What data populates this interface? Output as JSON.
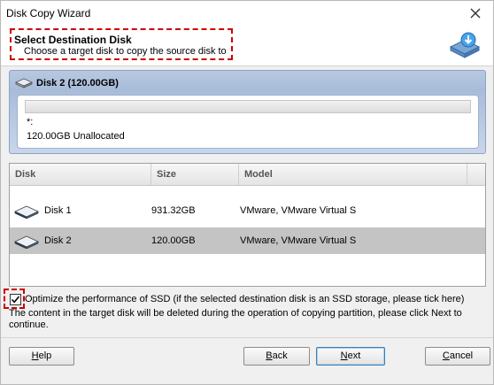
{
  "window": {
    "title": "Disk Copy Wizard"
  },
  "header": {
    "title": "Select Destination Disk",
    "subtitle": "Choose a target disk to copy the source disk to"
  },
  "disk_panel": {
    "title": "Disk 2 (120.00GB)",
    "partition_name": "*:",
    "partition_desc": "120.00GB Unallocated"
  },
  "table": {
    "columns": [
      "Disk",
      "Size",
      "Model"
    ],
    "rows": [
      {
        "disk": "Disk 1",
        "size": "931.32GB",
        "model": "VMware, VMware Virtual S",
        "selected": false
      },
      {
        "disk": "Disk 2",
        "size": "120.00GB",
        "model": "VMware, VMware Virtual S",
        "selected": true
      }
    ]
  },
  "options": {
    "ssd_label": "Optimize the performance of SSD (if the selected destination disk is an SSD storage, please tick here)",
    "ssd_checked": true
  },
  "note": "The content in the target disk will be deleted during the operation of copying partition, please click Next to continue.",
  "buttons": {
    "help": {
      "pre": "",
      "key": "H",
      "post": "elp"
    },
    "back": {
      "pre": "",
      "key": "B",
      "post": "ack"
    },
    "next": {
      "pre": "",
      "key": "N",
      "post": "ext"
    },
    "cancel": {
      "pre": "",
      "key": "C",
      "post": "ancel"
    }
  },
  "colors": {
    "highlight_dash": "#cc0000",
    "selected_row": "#c4c4c4",
    "panel_blue": "#a8bcd9"
  },
  "icons": [
    "close-icon",
    "disk-copy-icon",
    "disk-small-icon",
    "hard-disk-icon",
    "checkmark-icon"
  ]
}
